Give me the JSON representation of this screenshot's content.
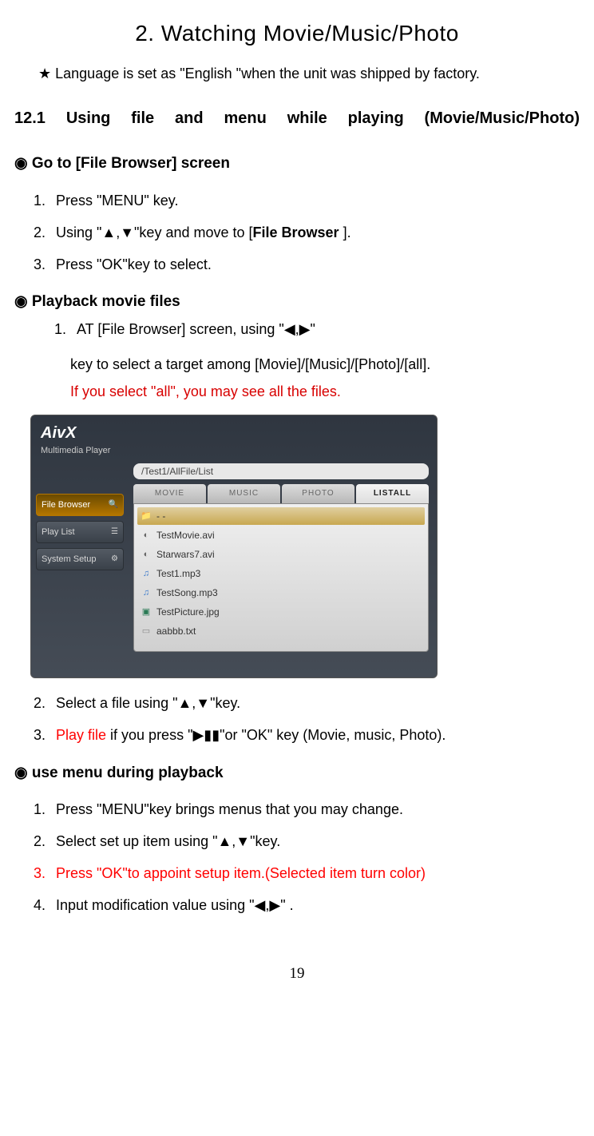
{
  "title": "2. Watching Movie/Music/Photo",
  "note_star": "★ Language is set as \"English \"when the unit was shipped by factory.",
  "section_number": "12.1  Using file and menu while playing (Movie/Music/Photo)",
  "h_file_browser": "Go to [File Browser] screen",
  "steps_file_browser": {
    "s1": "Press \"MENU\" key.",
    "s2a": "Using \"▲,▼\"key and move to   [",
    "s2b": "File Browser",
    "s2c": " ].",
    "s3": "Press \"OK\"key to select."
  },
  "h_playback": "Playback movie files",
  "playback": {
    "s1": "AT [File Browser] screen, using \"◀,▶\"",
    "line2": "key to select a target among [Movie]/[Music]/[Photo]/[all].",
    "line3": "If you select \"all\", you may see all the files."
  },
  "screenshot": {
    "logo": "AivX",
    "logo_sub": "Multimedia Player",
    "sidebar": {
      "item1": "File Browser",
      "item2": "Play List",
      "item3": "System Setup"
    },
    "path": "/Test1/AllFile/List",
    "tabs": {
      "t1": "MOVIE",
      "t2": "MUSIC",
      "t3": "PHOTO",
      "t4": "LISTALL"
    },
    "rows": {
      "r1": "- -",
      "r2": "TestMovie.avi",
      "r3": "Starwars7.avi",
      "r4": "Test1.mp3",
      "r5": "TestSong.mp3",
      "r6": "TestPicture.jpg",
      "r7": "aabbb.txt"
    }
  },
  "post_shot": {
    "s2": "Select a file using \"▲,▼\"key.",
    "s3_red": "Play file",
    "s3_rest": " if you press \"▶▮▮\"or \"OK\" key (Movie, music, Photo)."
  },
  "h_menu": "use menu during playback",
  "menu": {
    "s1": "Press \"MENU\"key brings menus that you may change.",
    "s2": "Select set up item using \"▲,▼\"key.",
    "s3": "Press \"OK\"to appoint setup item.(Selected item turn color)",
    "s4": "Input modification value using \"◀,▶\" ."
  },
  "page_number": "19"
}
